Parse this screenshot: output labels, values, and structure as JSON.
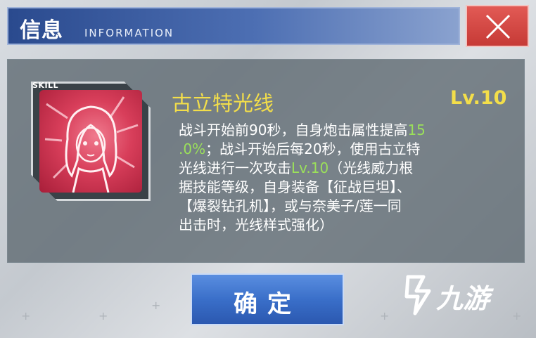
{
  "header": {
    "title_cn": "信息",
    "title_en": "INFORMATION"
  },
  "close_button": {
    "icon": "close-icon"
  },
  "skill": {
    "tag": "SKILL",
    "icon": "character-portrait-icon",
    "name": "古立特光线",
    "level": "Lv.10",
    "description_lines": [
      [
        {
          "t": "战斗开始前90秒，自身炮击属性提高"
        },
        {
          "t": "15",
          "hl": true
        }
      ],
      [
        {
          "t": ".0%",
          "hl": true
        },
        {
          "t": "；战斗开始后每20秒，使用古立特"
        }
      ],
      [
        {
          "t": "光线进行一次攻击"
        },
        {
          "t": "Lv.10",
          "hl": true
        },
        {
          "t": "（光线威力根"
        }
      ],
      [
        {
          "t": "据技能等级，自身装备【征战巨坦】、"
        }
      ],
      [
        {
          "t": "【爆裂钻孔机】，或与奈美子/莲一同"
        }
      ],
      [
        {
          "t": "出击时，光线样式强化）"
        }
      ]
    ]
  },
  "confirm_button": {
    "label": "确定"
  },
  "watermark": {
    "text": "九游",
    "icon": "jiuyou-logo-icon"
  },
  "colors": {
    "accent_yellow": "#f3de4a",
    "highlight_green": "#9be05a",
    "close_red": "#d24642",
    "button_blue": "#3a6fc9"
  }
}
